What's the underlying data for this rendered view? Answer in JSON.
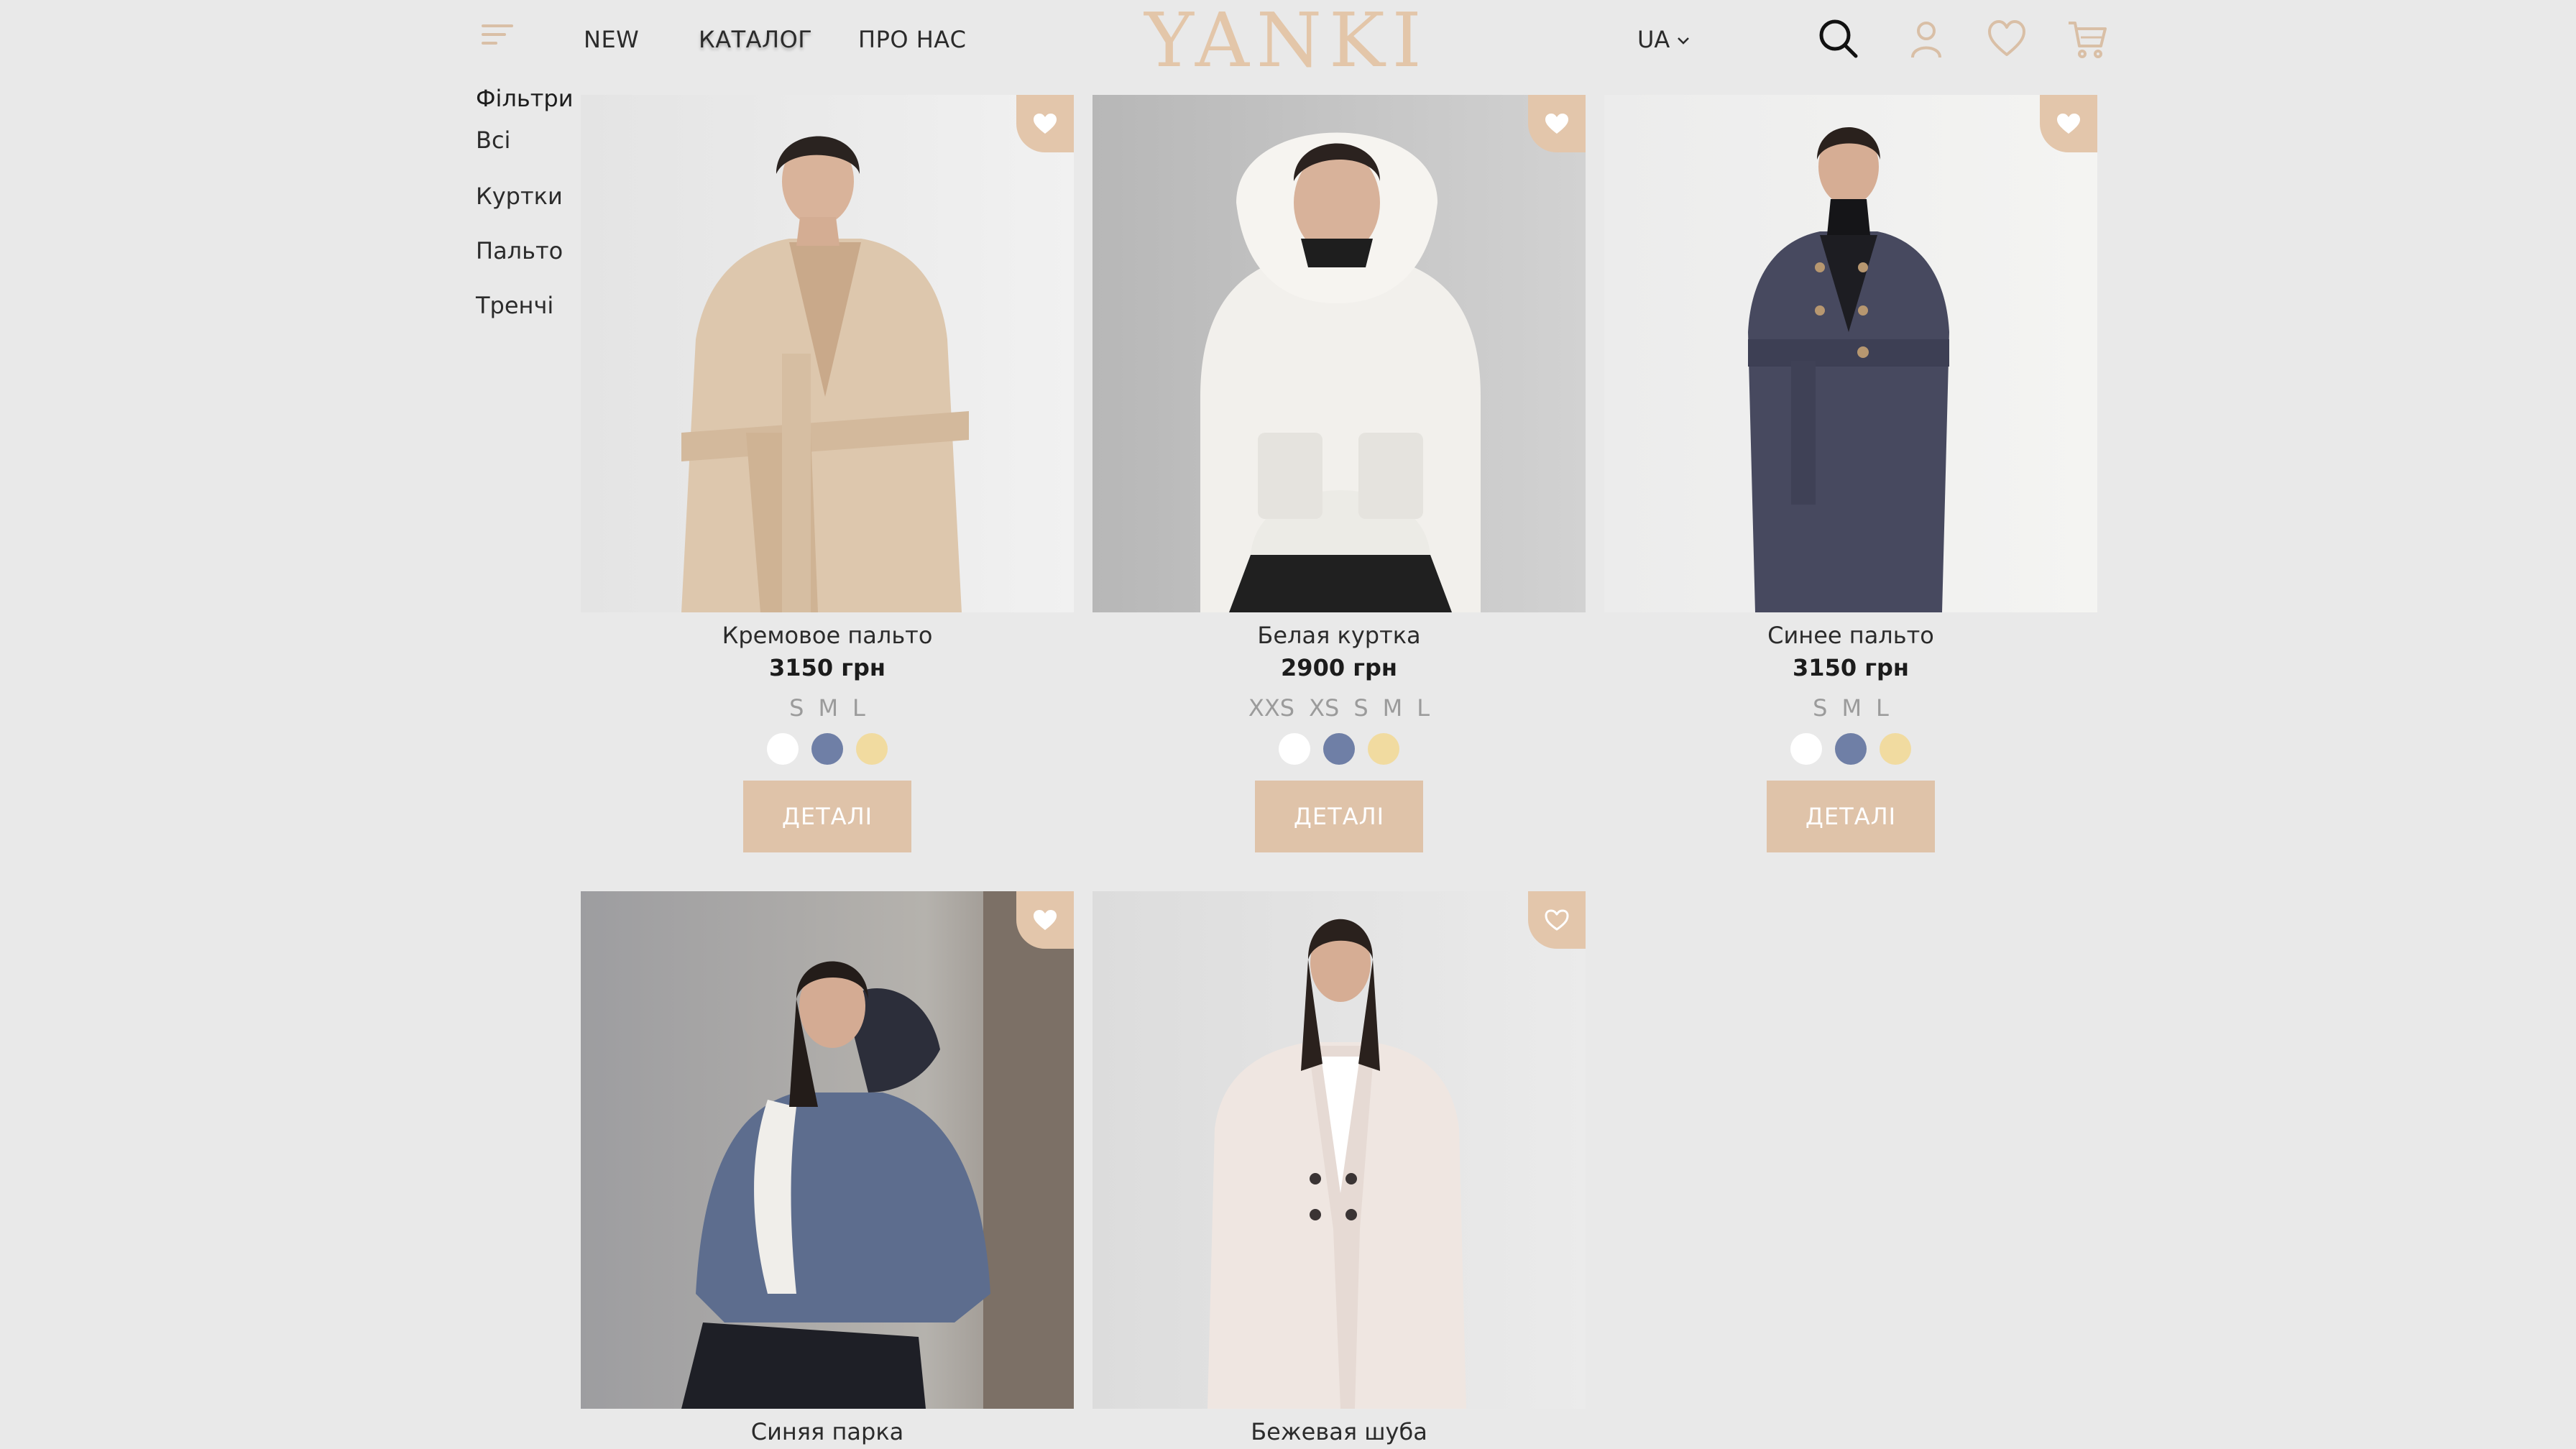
{
  "header": {
    "nav": [
      "NEW",
      "КАТАЛОГ",
      "ПРО НАС"
    ],
    "logo": "YANKI",
    "language": "UA",
    "icons": [
      "menu-icon",
      "search-icon",
      "user-icon",
      "heart-icon",
      "cart-icon"
    ]
  },
  "sidebar": {
    "title": "Фільтри",
    "items": [
      "Всі",
      "Куртки",
      "Пальто",
      "Тренчі"
    ]
  },
  "colors": {
    "background": "#e9e9e9",
    "accent": "#dfc3a9",
    "logo": "#e3c6a9",
    "swatch_white": "#ffffff",
    "swatch_blue": "#6f7fa6",
    "swatch_yellow": "#f1dba0"
  },
  "products": [
    {
      "name": "Кремовое пальто",
      "price": "3150 грн",
      "sizes": [
        "S",
        "M",
        "L"
      ],
      "swatches": [
        "#ffffff",
        "#6f7fa6",
        "#f1dba0"
      ],
      "details_label": "ДЕТАЛІ",
      "favorite": true
    },
    {
      "name": "Белая куртка",
      "price": "2900 грн",
      "sizes": [
        "XXS",
        "XS",
        "S",
        "M",
        "L"
      ],
      "swatches": [
        "#ffffff",
        "#6f7fa6",
        "#f1dba0"
      ],
      "details_label": "ДЕТАЛІ",
      "favorite": true
    },
    {
      "name": "Синее пальто",
      "price": "3150 грн",
      "sizes": [
        "S",
        "M",
        "L"
      ],
      "swatches": [
        "#ffffff",
        "#6f7fa6",
        "#f1dba0"
      ],
      "details_label": "ДЕТАЛІ",
      "favorite": true
    },
    {
      "name": "Синяя парка",
      "favorite": true
    },
    {
      "name": "Бежевая шуба",
      "favorite": false
    }
  ]
}
